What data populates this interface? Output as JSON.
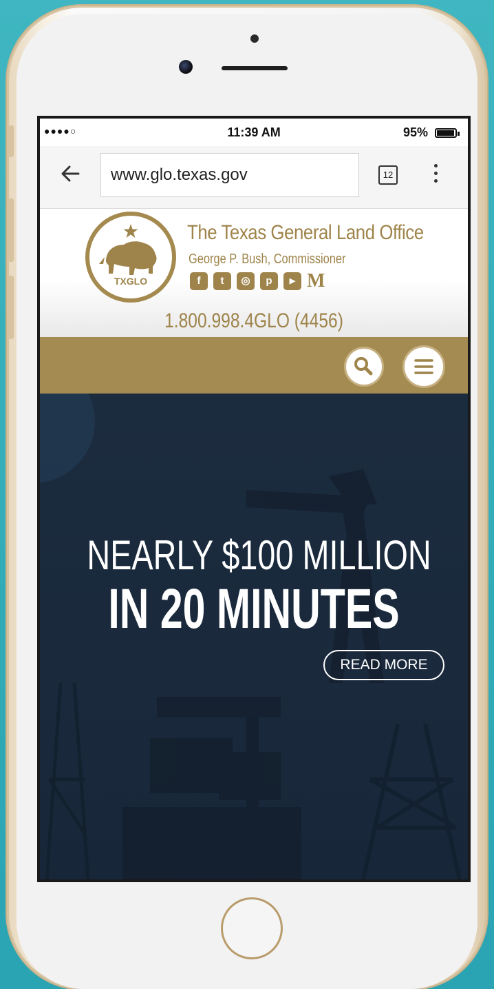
{
  "status_bar": {
    "signal": "●●●●○",
    "time": "11:39 AM",
    "battery_percent": "95%",
    "battery_level": 0.95
  },
  "browser": {
    "url": "www.glo.texas.gov",
    "tab_count": "12",
    "back_icon": "arrow-left-icon",
    "menu_icon": "more-vertical-icon"
  },
  "site": {
    "logo_text": "TXGLO",
    "title": "The Texas General Land Office",
    "subtitle": "George P. Bush, Commissioner",
    "social": [
      {
        "name": "facebook-icon",
        "glyph": "f"
      },
      {
        "name": "twitter-icon",
        "glyph": "t"
      },
      {
        "name": "instagram-icon",
        "glyph": "◎"
      },
      {
        "name": "pinterest-icon",
        "glyph": "p"
      },
      {
        "name": "youtube-icon",
        "glyph": "▶"
      },
      {
        "name": "medium-icon",
        "glyph": "M"
      }
    ],
    "phone": "1.800.998.4GLO (4456)",
    "accent_color": "#a48b52"
  },
  "nav": {
    "search_icon": "search-icon",
    "menu_icon": "hamburger-menu-icon"
  },
  "hero": {
    "line1": "NEARLY $100 MILLION",
    "line2": "IN 20 MINUTES",
    "cta": "READ MORE",
    "background_color": "#1b2b3d"
  }
}
